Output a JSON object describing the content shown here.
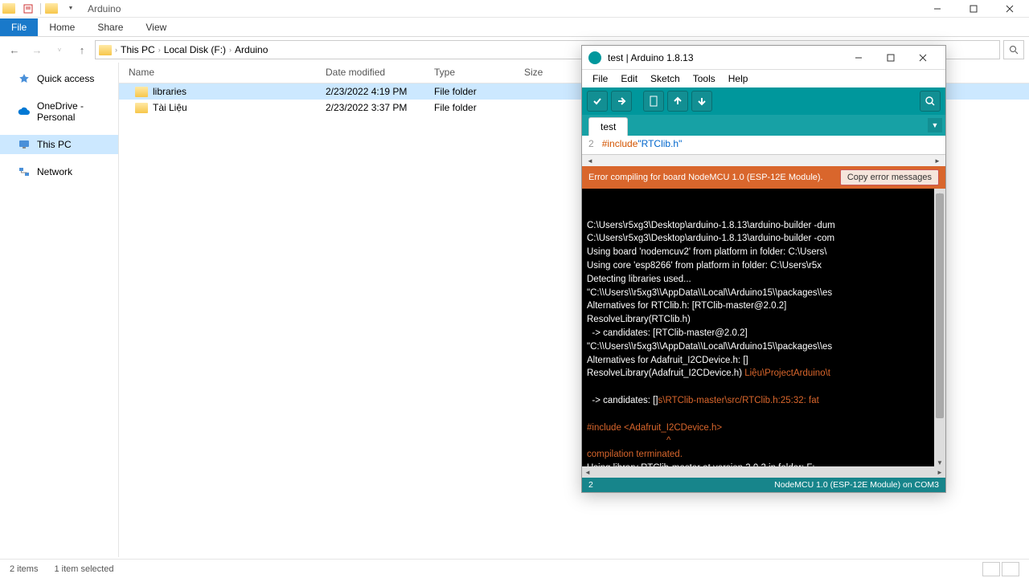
{
  "explorer": {
    "title": "Arduino",
    "ribbon": {
      "file": "File",
      "home": "Home",
      "share": "Share",
      "view": "View"
    },
    "breadcrumbs": [
      "This PC",
      "Local Disk (F:)",
      "Arduino"
    ],
    "nav": {
      "quick_access": "Quick access",
      "onedrive": "OneDrive - Personal",
      "this_pc": "This PC",
      "network": "Network"
    },
    "columns": {
      "name": "Name",
      "date": "Date modified",
      "type": "Type",
      "size": "Size"
    },
    "rows": [
      {
        "name": "libraries",
        "date": "2/23/2022 4:19 PM",
        "type": "File folder",
        "size": "",
        "selected": true
      },
      {
        "name": "Tài Liệu",
        "date": "2/23/2022 3:37 PM",
        "type": "File folder",
        "size": "",
        "selected": false
      }
    ],
    "status": {
      "items": "2 items",
      "selected": "1 item selected"
    }
  },
  "arduino": {
    "title": "test | Arduino 1.8.13",
    "menu": {
      "file": "File",
      "edit": "Edit",
      "sketch": "Sketch",
      "tools": "Tools",
      "help": "Help"
    },
    "tab": "test",
    "code": {
      "line_no": "2",
      "keyword": "#include ",
      "string": "\"RTClib.h\""
    },
    "error_msg": "Error compiling for board NodeMCU 1.0 (ESP-12E Module).",
    "copy_btn": "Copy error messages",
    "console_lines": [
      {
        "t": "C:\\Users\\r5xg3\\Desktop\\arduino-1.8.13\\arduino-builder -dum",
        "c": "w"
      },
      {
        "t": "C:\\Users\\r5xg3\\Desktop\\arduino-1.8.13\\arduino-builder -com",
        "c": "w"
      },
      {
        "t": "Using board 'nodemcuv2' from platform in folder: C:\\Users\\",
        "c": "w"
      },
      {
        "t": "Using core 'esp8266' from platform in folder: C:\\Users\\r5x",
        "c": "w"
      },
      {
        "t": "Detecting libraries used...",
        "c": "w"
      },
      {
        "t": "\"C:\\\\Users\\\\r5xg3\\\\AppData\\\\Local\\\\Arduino15\\\\packages\\\\es",
        "c": "w"
      },
      {
        "t": "Alternatives for RTClib.h: [RTClib-master@2.0.2]",
        "c": "w"
      },
      {
        "t": "ResolveLibrary(RTClib.h)",
        "c": "w"
      },
      {
        "t": "  -> candidates: [RTClib-master@2.0.2]",
        "c": "w"
      },
      {
        "t": "\"C:\\\\Users\\\\r5xg3\\\\AppData\\\\Local\\\\Arduino15\\\\packages\\\\es",
        "c": "w"
      },
      {
        "t": "Alternatives for Adafruit_I2CDevice.h: []",
        "c": "w"
      },
      {
        "t": "ResolveLibrary(Adafruit_I2CDevice.h) ",
        "c": "w",
        "tail": "Liệu\\ProjectArduino\\t"
      },
      {
        "t": "",
        "c": "w"
      },
      {
        "t": "  -> candidates: []",
        "c": "w",
        "tail": "s\\RTClib-master\\src/RTClib.h:25:32: fat"
      },
      {
        "t": "",
        "c": "w"
      },
      {
        "t": "#include <Adafruit_I2CDevice.h>",
        "c": "e"
      },
      {
        "t": "                               ^",
        "c": "e"
      },
      {
        "t": "compilation terminated.",
        "c": "e"
      },
      {
        "t": "Using library RTClib-master at version 2.0.2 in folder: F:",
        "c": "w"
      }
    ],
    "status": {
      "left": "2",
      "right": "NodeMCU 1.0 (ESP-12E Module) on COM3"
    }
  }
}
